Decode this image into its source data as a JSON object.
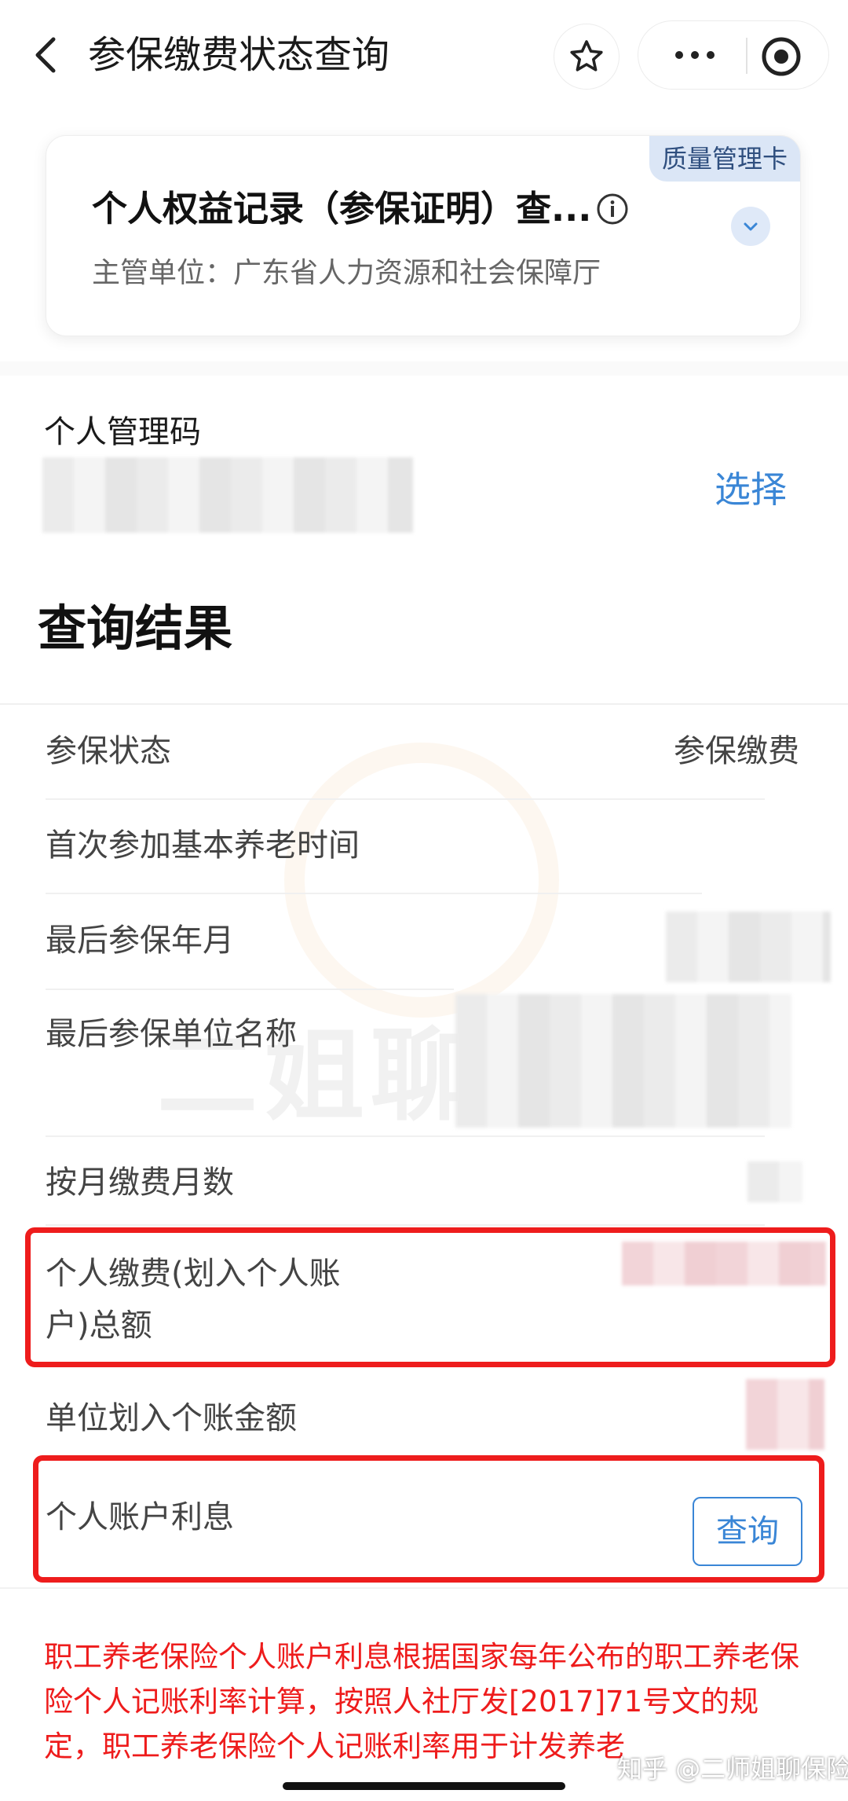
{
  "header": {
    "title": "参保缴费状态查询"
  },
  "card": {
    "tag": "质量管理卡",
    "title": "个人权益记录（参保证明）查...",
    "subtitle": "主管单位：广东省人力资源和社会保障厅"
  },
  "personal_code": {
    "label": "个人管理码",
    "select_label": "选择"
  },
  "results": {
    "title": "查询结果",
    "rows": [
      {
        "label": "参保状态",
        "value": "参保缴费"
      },
      {
        "label": "首次参加基本养老时间"
      },
      {
        "label": "最后参保年月"
      },
      {
        "label": "最后参保单位名称"
      },
      {
        "label": "按月缴费月数"
      },
      {
        "label": "个人缴费(划入个人账",
        "label2": "户)总额"
      },
      {
        "label": "单位划入个账金额"
      },
      {
        "label": "个人账户利息",
        "button": "查询"
      }
    ]
  },
  "watermark": "二姐聊保障",
  "note": "职工养老保险个人账户利息根据国家每年公布的职工养老保险个人记账利率计算，按照人社厅发[2017]71号文的规定，职工养老保险个人记账利率用于计发养老",
  "source_mark": "知乎 @二师姐聊保险",
  "colors": {
    "accent_blue": "#3a86d6",
    "highlight_red": "#ee1c1c",
    "tag_bg": "#dbe6f6"
  },
  "icons": [
    "back-arrow-icon",
    "star-icon",
    "more-icon",
    "target-icon",
    "info-icon",
    "chevron-down-icon"
  ]
}
